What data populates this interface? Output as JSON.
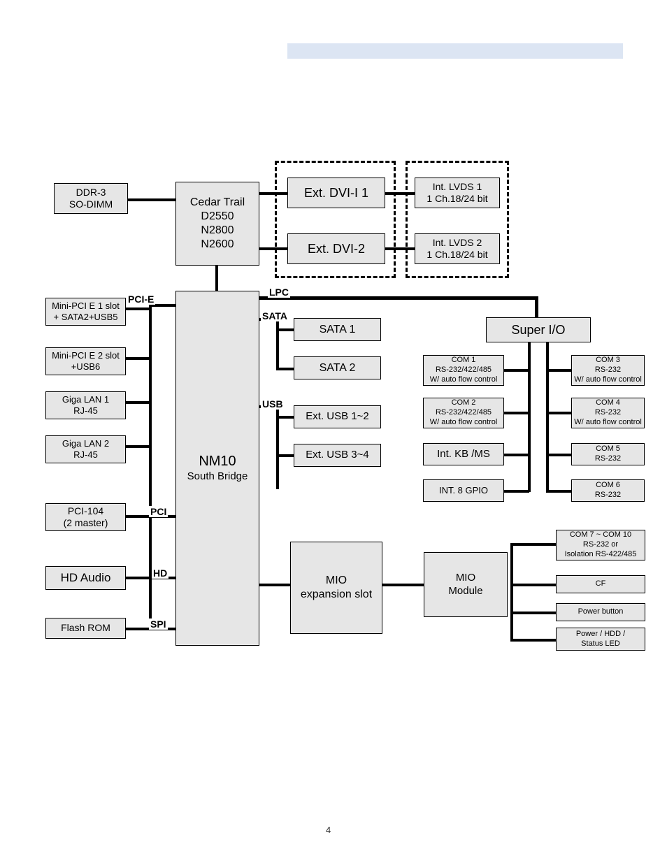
{
  "page": {
    "number": "4"
  },
  "blocks": {
    "ddr": "DDR-3\nSO-DIMM",
    "cpu": "Cedar Trail\nD2550\nN2800\nN2600",
    "dvi1": "Ext. DVI-I 1",
    "dvi2": "Ext. DVI-2",
    "lvds1": "Int. LVDS 1\n1 Ch.18/24 bit",
    "lvds2": "Int. LVDS 2\n1 Ch.18/24 bit",
    "nm10_title": "NM10",
    "nm10_sub": "South Bridge",
    "minipcie1": "Mini-PCI E 1 slot\n+ SATA2+USB5",
    "minipcie2": "Mini-PCI E 2 slot\n+USB6",
    "lan1": "Giga LAN 1\nRJ-45",
    "lan2": "Giga LAN 2\nRJ-45",
    "pci104": "PCI-104\n(2 master)",
    "hdaudio": "HD Audio",
    "flashrom": "Flash ROM",
    "sata1": "SATA 1",
    "sata2": "SATA 2",
    "usb12": "Ext. USB 1~2",
    "usb34": "Ext. USB 3~4",
    "superio": "Super I/O",
    "com1": "COM 1\nRS-232/422/485\nW/ auto flow control",
    "com2": "COM 2\nRS-232/422/485\nW/ auto flow control",
    "com3": "COM 3\nRS-232\nW/ auto flow control",
    "com4": "COM 4\nRS-232\nW/ auto flow control",
    "com5": "COM 5\nRS-232",
    "com6": "COM 6\nRS-232",
    "kbms": "Int. KB /MS",
    "gpio": "INT. 8 GPIO",
    "mio_slot": "MIO\nexpansion slot",
    "mio_module": "MIO\nModule",
    "com710": "COM 7 ~ COM 10\nRS-232 or\nIsolation RS-422/485",
    "cf": "CF",
    "pwrbtn": "Power button",
    "led": "Power / HDD /\nStatus LED"
  },
  "bus_labels": {
    "pcie": "PCI-E",
    "lpc": "LPC",
    "sata": "SATA",
    "usb": "USB",
    "pci": "PCI",
    "hd": "HD",
    "spi": "SPI"
  }
}
